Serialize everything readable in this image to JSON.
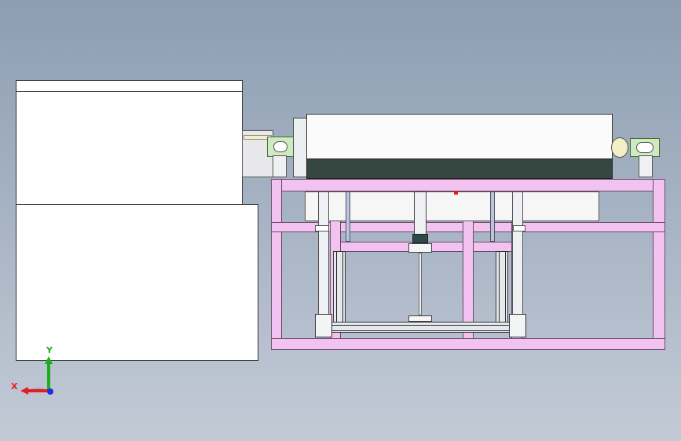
{
  "viewport": {
    "background_top": "#8d9db2",
    "background_bottom": "#c3cad6"
  },
  "triad": {
    "x_label": "X",
    "y_label": "Y",
    "x_color": "#e02020",
    "y_color": "#18b018",
    "z_color": "#1830e0"
  },
  "frame_color": "#f2c3f0",
  "belt_color": "#354740"
}
